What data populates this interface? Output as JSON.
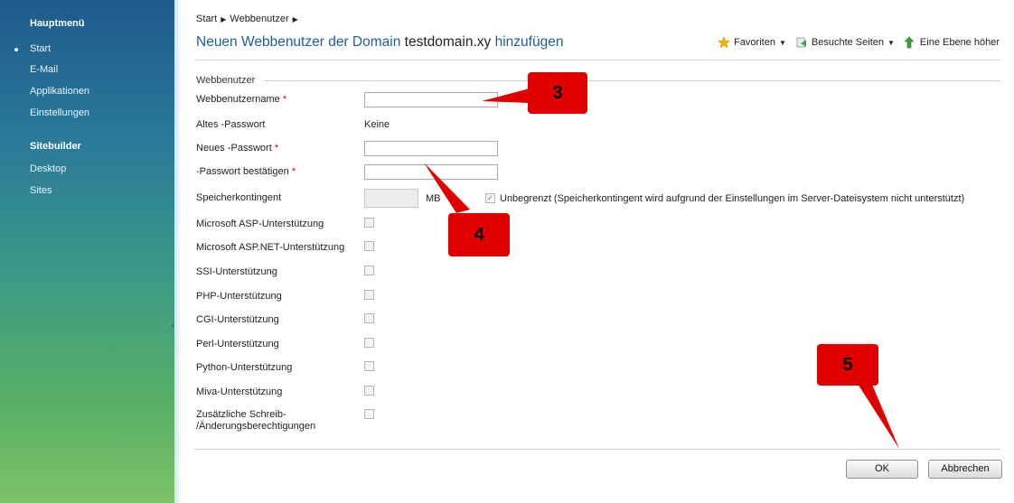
{
  "sidebar": {
    "main_menu_title": "Hauptmenü",
    "main_items": [
      {
        "label": "Start",
        "active": true
      },
      {
        "label": "E-Mail"
      },
      {
        "label": "Applikationen"
      },
      {
        "label": "Einstellungen"
      }
    ],
    "sitebuilder_title": "Sitebuilder",
    "sitebuilder_items": [
      {
        "label": "Desktop"
      },
      {
        "label": "Sites"
      }
    ]
  },
  "breadcrumb": [
    "Start",
    "Webbenutzer"
  ],
  "page_title": {
    "prefix": "Neuen Webbenutzer der Domain",
    "domain": "testdomain.xy",
    "suffix": "hinzufügen"
  },
  "toolbar": {
    "favorites": "Favoriten",
    "visited_pages": "Besuchte Seiten",
    "level_up": "Eine Ebene höher"
  },
  "form": {
    "section_legend": "Webbenutzer",
    "username_label": "Webbenutzername",
    "old_password_label": "Altes -Passwort",
    "old_password_value": "Keine",
    "new_password_label": "Neues -Passwort",
    "confirm_password_label": "-Passwort bestätigen",
    "quota_label": "Speicherkontingent",
    "quota_unit": "MB",
    "unlimited_text": "Unbegrenzt (Speicherkontingent wird aufgrund der Einstellungen im Server-Dateisystem nicht unterstützt)",
    "required_marker": "*",
    "options": [
      "Microsoft ASP-Unterstützung",
      "Microsoft ASP.NET-Unterstützung",
      "SSI-Unterstützung",
      "PHP-Unterstützung",
      "CGI-Unterstützung",
      "Perl-Unterstützung",
      "Python-Unterstützung",
      "Miva-Unterstützung"
    ],
    "extra_permissions_line1": "Zusätzliche Schreib-",
    "extra_permissions_line2": "/Änderungsberechtigungen"
  },
  "buttons": {
    "ok": "OK",
    "cancel": "Abbrechen"
  },
  "callouts": [
    "3",
    "4",
    "5"
  ],
  "colors": {
    "callout": "#e00000",
    "title": "#1f5c9c",
    "required": "#cc0000"
  }
}
